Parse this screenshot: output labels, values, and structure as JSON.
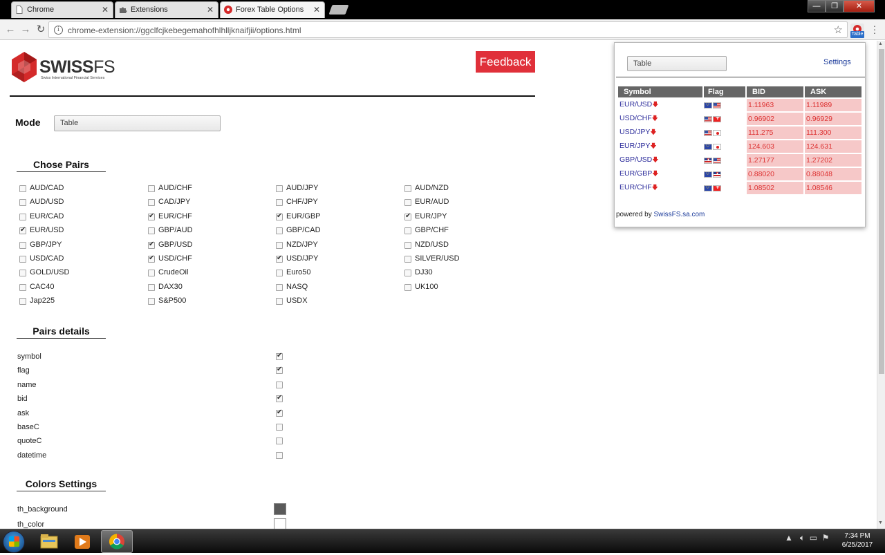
{
  "browser": {
    "tabs": [
      {
        "title": "Chrome"
      },
      {
        "title": "Extensions"
      },
      {
        "title": "Forex Table Options"
      }
    ],
    "url": "chrome-extension://ggclfcjkebegemahofhlhlljknaifjii/options.html",
    "extension_badge": "Table"
  },
  "page": {
    "logo_brand": "SWISS",
    "logo_brand_suffix": "FS",
    "logo_subtitle": "Swiss International Financial Services",
    "feedback_label": "Feedback",
    "mode_label": "Mode",
    "mode_value": "Table",
    "chose_pairs_title": "Chose Pairs",
    "pairs": [
      {
        "label": "AUD/CAD",
        "checked": false
      },
      {
        "label": "AUD/CHF",
        "checked": false
      },
      {
        "label": "AUD/JPY",
        "checked": false
      },
      {
        "label": "AUD/NZD",
        "checked": false
      },
      {
        "label": "AUD/USD",
        "checked": false
      },
      {
        "label": "CAD/JPY",
        "checked": false
      },
      {
        "label": "CHF/JPY",
        "checked": false
      },
      {
        "label": "EUR/AUD",
        "checked": false
      },
      {
        "label": "EUR/CAD",
        "checked": false
      },
      {
        "label": "EUR/CHF",
        "checked": true
      },
      {
        "label": "EUR/GBP",
        "checked": true
      },
      {
        "label": "EUR/JPY",
        "checked": true
      },
      {
        "label": "EUR/USD",
        "checked": true
      },
      {
        "label": "GBP/AUD",
        "checked": false
      },
      {
        "label": "GBP/CAD",
        "checked": false
      },
      {
        "label": "GBP/CHF",
        "checked": false
      },
      {
        "label": "GBP/JPY",
        "checked": false
      },
      {
        "label": "GBP/USD",
        "checked": true
      },
      {
        "label": "NZD/JPY",
        "checked": false
      },
      {
        "label": "NZD/USD",
        "checked": false
      },
      {
        "label": "USD/CAD",
        "checked": false
      },
      {
        "label": "USD/CHF",
        "checked": true
      },
      {
        "label": "USD/JPY",
        "checked": true
      },
      {
        "label": "SILVER/USD",
        "checked": false
      },
      {
        "label": "GOLD/USD",
        "checked": false
      },
      {
        "label": "CrudeOil",
        "checked": false
      },
      {
        "label": "Euro50",
        "checked": false
      },
      {
        "label": "DJ30",
        "checked": false
      },
      {
        "label": "CAC40",
        "checked": false
      },
      {
        "label": "DAX30",
        "checked": false
      },
      {
        "label": "NASQ",
        "checked": false
      },
      {
        "label": "UK100",
        "checked": false
      },
      {
        "label": "Jap225",
        "checked": false
      },
      {
        "label": "S&P500",
        "checked": false
      },
      {
        "label": "USDX",
        "checked": false
      }
    ],
    "pairs_details_title": "Pairs details",
    "details": [
      {
        "label": "symbol",
        "checked": true
      },
      {
        "label": "flag",
        "checked": true
      },
      {
        "label": "name",
        "checked": false
      },
      {
        "label": "bid",
        "checked": true
      },
      {
        "label": "ask",
        "checked": true
      },
      {
        "label": "baseC",
        "checked": false
      },
      {
        "label": "quoteC",
        "checked": false
      },
      {
        "label": "datetime",
        "checked": false
      }
    ],
    "colors_title": "Colors Settings",
    "colors": [
      {
        "label": "th_background",
        "value": "#5a5a5a"
      },
      {
        "label": "th_color",
        "value": "#ffffff"
      }
    ]
  },
  "popup": {
    "mode_value": "Table",
    "settings_link": "Settings",
    "columns": [
      "Symbol",
      "Flag",
      "BID",
      "ASK"
    ],
    "rows": [
      {
        "symbol": "EUR/USD",
        "flags": [
          "eu",
          "us"
        ],
        "bid": "1.11963",
        "ask": "1.11989"
      },
      {
        "symbol": "USD/CHF",
        "flags": [
          "us",
          "ch"
        ],
        "bid": "0.96902",
        "ask": "0.96929"
      },
      {
        "symbol": "USD/JPY",
        "flags": [
          "us",
          "jp"
        ],
        "bid": "111.275",
        "ask": "111.300"
      },
      {
        "symbol": "EUR/JPY",
        "flags": [
          "eu",
          "jp"
        ],
        "bid": "124.603",
        "ask": "124.631"
      },
      {
        "symbol": "GBP/USD",
        "flags": [
          "gb",
          "us"
        ],
        "bid": "1.27177",
        "ask": "1.27202"
      },
      {
        "symbol": "EUR/GBP",
        "flags": [
          "eu",
          "gb"
        ],
        "bid": "0.88020",
        "ask": "0.88048"
      },
      {
        "symbol": "EUR/CHF",
        "flags": [
          "eu",
          "ch"
        ],
        "bid": "1.08502",
        "ask": "1.08546"
      }
    ],
    "powered_prefix": "powered by ",
    "powered_link": "SwissFS.sa.com"
  },
  "taskbar": {
    "time": "7:34 PM",
    "date": "6/25/2017"
  }
}
